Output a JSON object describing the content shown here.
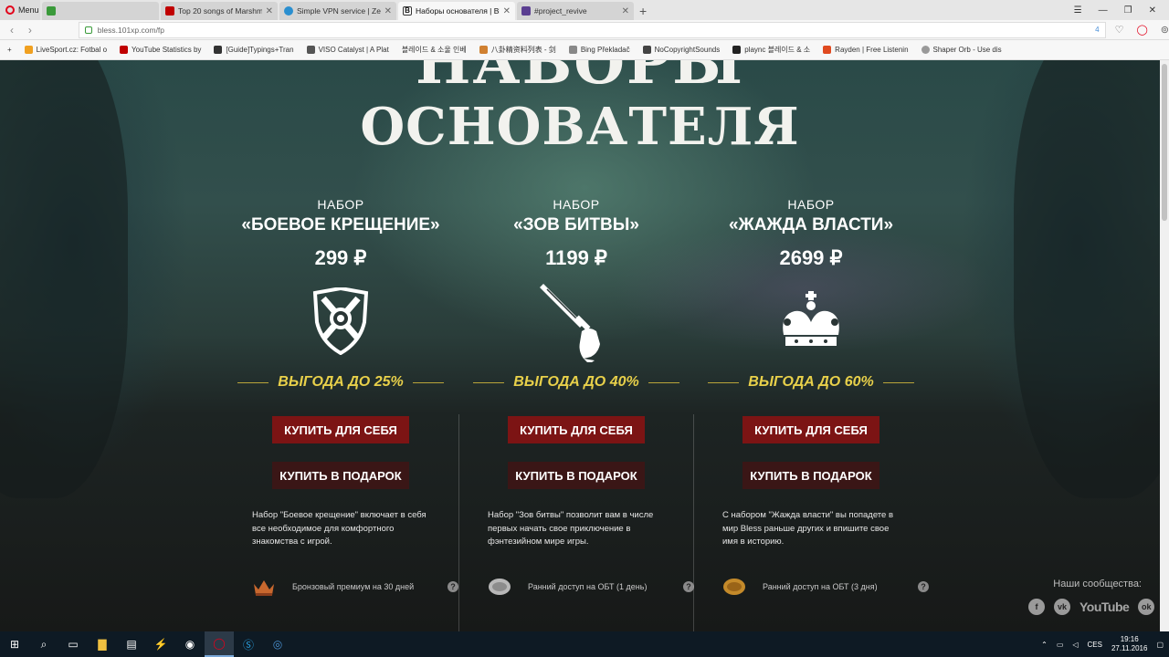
{
  "browser": {
    "menu_label": "Menu",
    "tabs": [
      {
        "label": "Top 20 songs of Marshme",
        "color": "#c00000"
      },
      {
        "label": "Simple VPN service | Zen",
        "color": "#2a8fd0"
      },
      {
        "label": "Наборы основателя | Bles",
        "color": "#333333"
      },
      {
        "label": "#project_revive",
        "color": "#5a3e91"
      }
    ],
    "url": "bless.101xp.com/fp",
    "badge_count": "4",
    "bookmarks": [
      "LiveSport.cz: Fotbal o",
      "YouTube Statistics by",
      "[Guide]Typings+Tran",
      "VISO Catalyst | A Plat",
      "블레이드 & 소울 인베",
      "八卦精资料列表 - 剑",
      "Bing Překladač",
      "NoCopyrightSounds",
      "plaync 블레이드 & 소",
      "Rayden | Free Listenin",
      "Shaper Orb - Use dis"
    ]
  },
  "page": {
    "title_top": "НАБОРЫ",
    "title_main": "ОСНОВАТЕЛЯ",
    "buy_self_label": "КУПИТЬ ДЛЯ СЕБЯ",
    "buy_gift_label": "КУПИТЬ В ПОДАРОК",
    "packs": [
      {
        "prefix": "НАБОР",
        "name": "«БОЕВОЕ КРЕЩЕНИЕ»",
        "price": "299 ₽",
        "icon": "shield-icon",
        "benefit": "ВЫГОДА ДО 25%",
        "description": "Набор \"Боевое крещение\" включает в себя все необходимое для комфортного знакомства с игрой.",
        "feature": "Бронзовый премиум на 30 дней",
        "feature_icon": "crown-bronze-icon"
      },
      {
        "prefix": "НАБОР",
        "name": "«ЗОВ БИТВЫ»",
        "price": "1199 ₽",
        "icon": "sword-fist-icon",
        "benefit": "ВЫГОДА ДО 40%",
        "description": "Набор \"Зов битвы\" позволит вам в числе первых начать свое приключение в фэнтезийном мире игры.",
        "feature": "Ранний доступ на ОБТ (1 день)",
        "feature_icon": "silver-token-icon"
      },
      {
        "prefix": "НАБОР",
        "name": "«ЖАЖДА ВЛАСТИ»",
        "price": "2699 ₽",
        "icon": "crown-icon",
        "benefit": "ВЫГОДА ДО 60%",
        "description": "С набором \"Жажда власти\" вы попадете в мир Bless раньше других и впишите свое имя в историю.",
        "feature": "Ранний доступ на ОБТ (3 дня)",
        "feature_icon": "gold-token-icon"
      }
    ],
    "community_label": "Наши сообщества:",
    "social": [
      "f",
      "vk",
      "YouTube",
      "ok"
    ]
  },
  "taskbar": {
    "lang": "CES",
    "time": "19:16",
    "date": "27.11.2016"
  },
  "colors": {
    "buy_button": "#7c1414",
    "gift_button": "#3a1616",
    "benefit_text": "#e8d04a"
  }
}
